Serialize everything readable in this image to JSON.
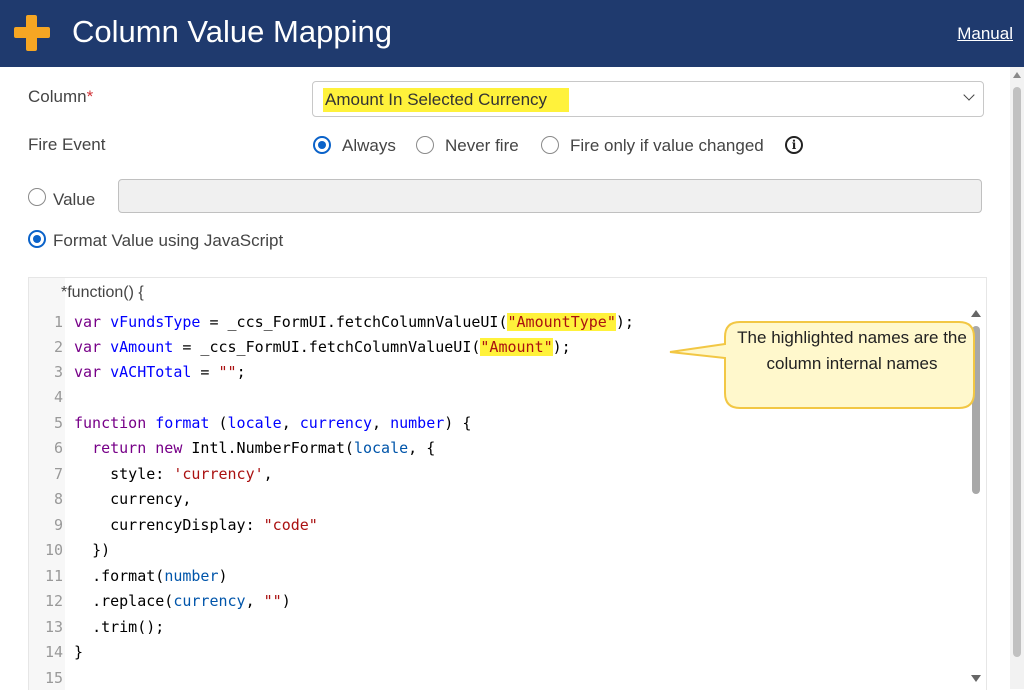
{
  "header": {
    "title": "Column Value Mapping",
    "manual_link": "Manual"
  },
  "form": {
    "column_label": "Column",
    "required_mark": "*",
    "column_value": "Amount In Selected Currency",
    "fire_event_label": "Fire Event",
    "fire_options": [
      "Always",
      "Never fire",
      "Fire only if value changed"
    ],
    "fire_selected": "Always",
    "value_label": "Value",
    "value_text": "",
    "format_label": "Format Value using JavaScript"
  },
  "editor": {
    "header_text": "*function() {",
    "line_numbers": [
      "1",
      "2",
      "3",
      "4",
      "5",
      "6",
      "7",
      "8",
      "9",
      "10",
      "11",
      "12",
      "13",
      "14",
      "15"
    ],
    "code": {
      "l1_kw": "var",
      "l1_name": "vFundsType",
      "l1_mid": " =  _ccs_FormUI.fetchColumnValueUI(",
      "l1_str": "\"AmountType\"",
      "l1_end": ");",
      "l2_kw": "var",
      "l2_name": "vAmount",
      "l2_mid": " = _ccs_FormUI.fetchColumnValueUI(",
      "l2_str": "\"Amount\"",
      "l2_end": ");",
      "l3_kw": "var",
      "l3_name": "vACHTotal",
      "l3_mid": " = ",
      "l3_str": "\"\"",
      "l3_end": ";",
      "l5_kw": "function",
      "l5_name": "format",
      "l5_p1": " (",
      "l5_a1": "locale",
      "l5_c1": ", ",
      "l5_a2": "currency",
      "l5_c2": ", ",
      "l5_a3": "number",
      "l5_end": ") {",
      "l6_kw1": "return",
      "l6_kw2": "new",
      "l6_mid": " Intl.NumberFormat(",
      "l6_arg": "locale",
      "l6_end": ", {",
      "l7_key": "style: ",
      "l7_str": "'currency'",
      "l7_end": ",",
      "l8": "currency,",
      "l9_key": "currencyDisplay: ",
      "l9_str": "\"code\"",
      "l10": "})",
      "l11_pre": ".format(",
      "l11_arg": "number",
      "l11_end": ")",
      "l12_pre": ".replace(",
      "l12_arg": "currency",
      "l12_mid": ", ",
      "l12_str": "\"\"",
      "l12_end": ")",
      "l13": ".trim();",
      "l14": "}"
    }
  },
  "callout": {
    "text": "The highlighted names are the column internal names"
  },
  "colors": {
    "header_bg": "#1f3a6e",
    "accent": "#f6a623",
    "highlight": "#fff23b",
    "radio_selected": "#0a62c9"
  },
  "icons": [
    "plus-icon",
    "chevron-down-icon",
    "info-icon"
  ]
}
